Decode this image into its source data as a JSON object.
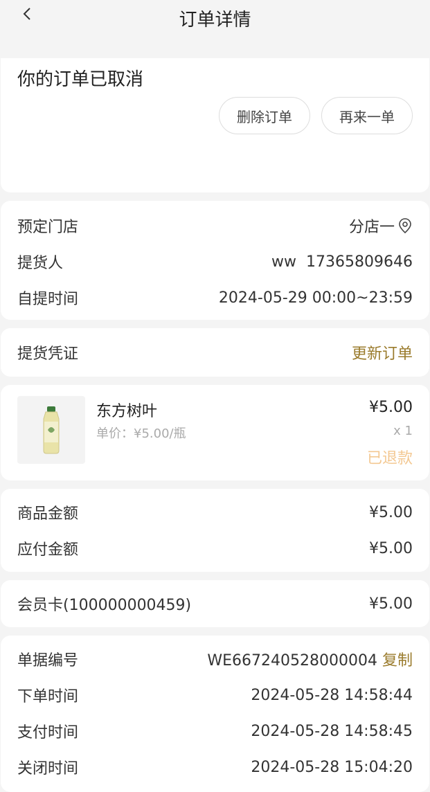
{
  "header": {
    "title": "订单详情"
  },
  "status": {
    "text": "你的订单已取消",
    "delete_label": "删除订单",
    "again_label": "再来一单"
  },
  "pickup_info": {
    "store_label": "预定门店",
    "store_value": "分店一",
    "person_label": "提货人",
    "person_value": "ww  17365809646",
    "time_label": "自提时间",
    "time_value": "2024-05-29 00:00~23:59"
  },
  "voucher": {
    "label": "提货凭证",
    "action": "更新订单"
  },
  "product": {
    "name": "东方树叶",
    "unit_price": "单价：¥5.00/瓶",
    "price": "¥5.00",
    "qty": "x 1",
    "status": "已退款"
  },
  "amounts": {
    "goods_label": "商品金额",
    "goods_value": "¥5.00",
    "payable_label": "应付金额",
    "payable_value": "¥5.00"
  },
  "member": {
    "label": "会员卡(100000000459)",
    "value": "¥5.00"
  },
  "order_meta": {
    "number_label": "单据编号",
    "number_value": "WE667240528000004",
    "copy_label": "复制",
    "created_label": "下单时间",
    "created_value": "2024-05-28 14:58:44",
    "paid_label": "支付时间",
    "paid_value": "2024-05-28 14:58:45",
    "closed_label": "关闭时间",
    "closed_value": "2024-05-28 15:04:20"
  },
  "colors": {
    "accent": "#9a7b2c",
    "red": "#e53935",
    "refund": "#f3c892"
  }
}
